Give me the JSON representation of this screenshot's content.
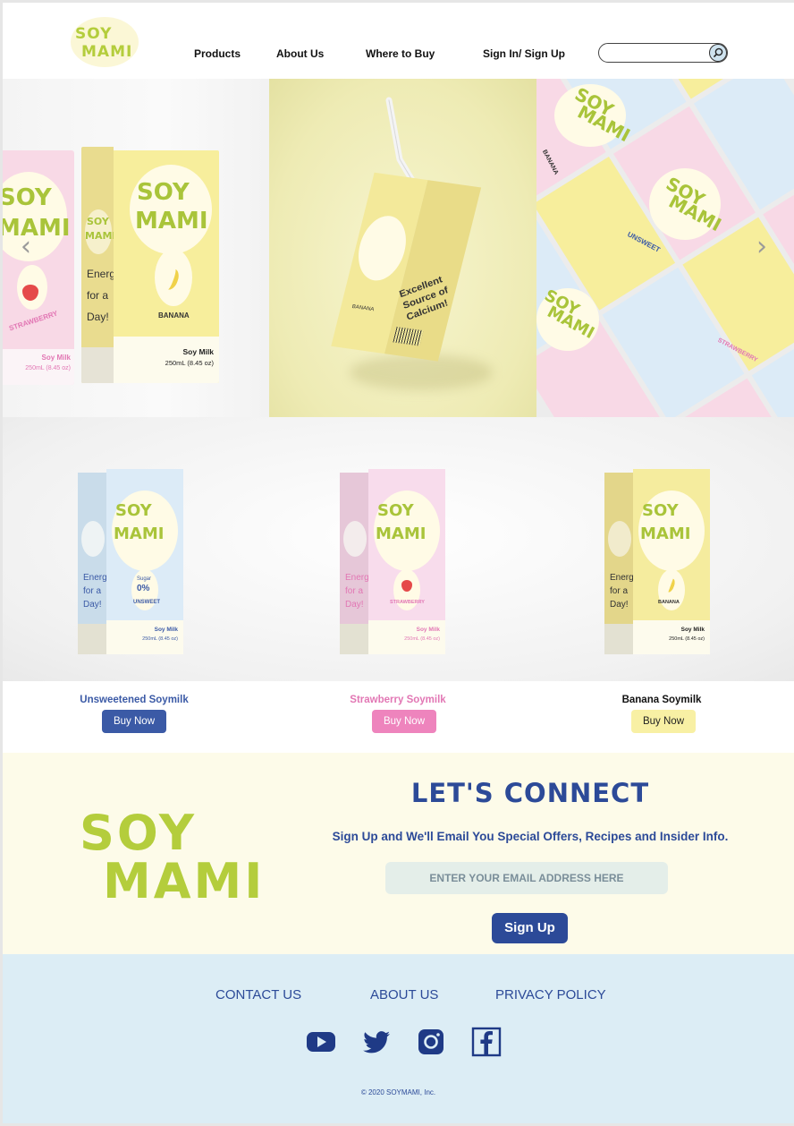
{
  "brand": {
    "line1": "SOY",
    "line2": "MAMI",
    "colors": {
      "green": "#b4cd3c",
      "navy": "#2c4a98",
      "cream": "#fdfbe9",
      "light_blue": "#dcedf5"
    }
  },
  "nav": {
    "items": [
      "Products",
      "About Us",
      "Where to Buy",
      "Sign In/ Sign Up"
    ]
  },
  "search": {
    "placeholder": "",
    "icon": "search-icon"
  },
  "hero": {
    "prev_icon": "‹",
    "next_icon": "›",
    "slides": [
      {
        "front_text": "Energy for a Day!",
        "flavor": "BANANA",
        "label": "Soy Milk",
        "size": "250mL (8.45 oz)",
        "side_flavor": "STRAWBERRY"
      },
      {
        "front_text": "Excellent Source of Calcium!",
        "flavor": "BANANA"
      },
      {
        "flavors": [
          "BANANA",
          "UNSWEET",
          "STRAWBERRY"
        ]
      }
    ]
  },
  "products": [
    {
      "name": "Unsweetened Soymilk",
      "button": "Buy Now",
      "tagline": "Energy for a Day!",
      "badge_top": "Sugar",
      "badge_value": "0%",
      "flavor": "UNSWEET",
      "label": "Soy Milk",
      "size": "250mL (8.45 oz)",
      "text_color": "#3b5aa6",
      "button_color": "#3b5aa6",
      "button_text_color": "#ffffff",
      "carton_color": "#dcebf7",
      "tag_color": "#3b5aa6"
    },
    {
      "name": "Strawberry Soymilk",
      "button": "Buy Now",
      "tagline": "Energy for a Day!",
      "badge_top": "",
      "badge_value": "",
      "flavor": "STRAWBERRY",
      "label": "Soy Milk",
      "size": "250mL (8.45 oz)",
      "text_color": "#e277b4",
      "button_color": "#ee84bd",
      "button_text_color": "#ffffff",
      "carton_color": "#f8dcec",
      "tag_color": "#e277b4"
    },
    {
      "name": "Banana Soymilk",
      "button": "Buy Now",
      "tagline": "Energy for a Day!",
      "badge_top": "",
      "badge_value": "",
      "flavor": "BANANA",
      "label": "Soy Milk",
      "size": "250mL (8.45 oz)",
      "text_color": "#111111",
      "button_color": "#f8f0a4",
      "button_text_color": "#222222",
      "carton_color": "#f5ec9e",
      "tag_color": "#333333"
    }
  ],
  "connect": {
    "title": "LET'S CONNECT",
    "subtitle": "Sign Up and We'll Email You Special Offers, Recipes and Insider Info.",
    "email_placeholder": "ENTER YOUR EMAIL ADDRESS HERE",
    "button": "Sign Up"
  },
  "footer": {
    "links": [
      "CONTACT US",
      "ABOUT US",
      "PRIVACY POLICY"
    ],
    "social": [
      "youtube-icon",
      "twitter-icon",
      "instagram-icon",
      "facebook-icon"
    ],
    "copyright": "© 2020 SOYMAMI, Inc."
  }
}
